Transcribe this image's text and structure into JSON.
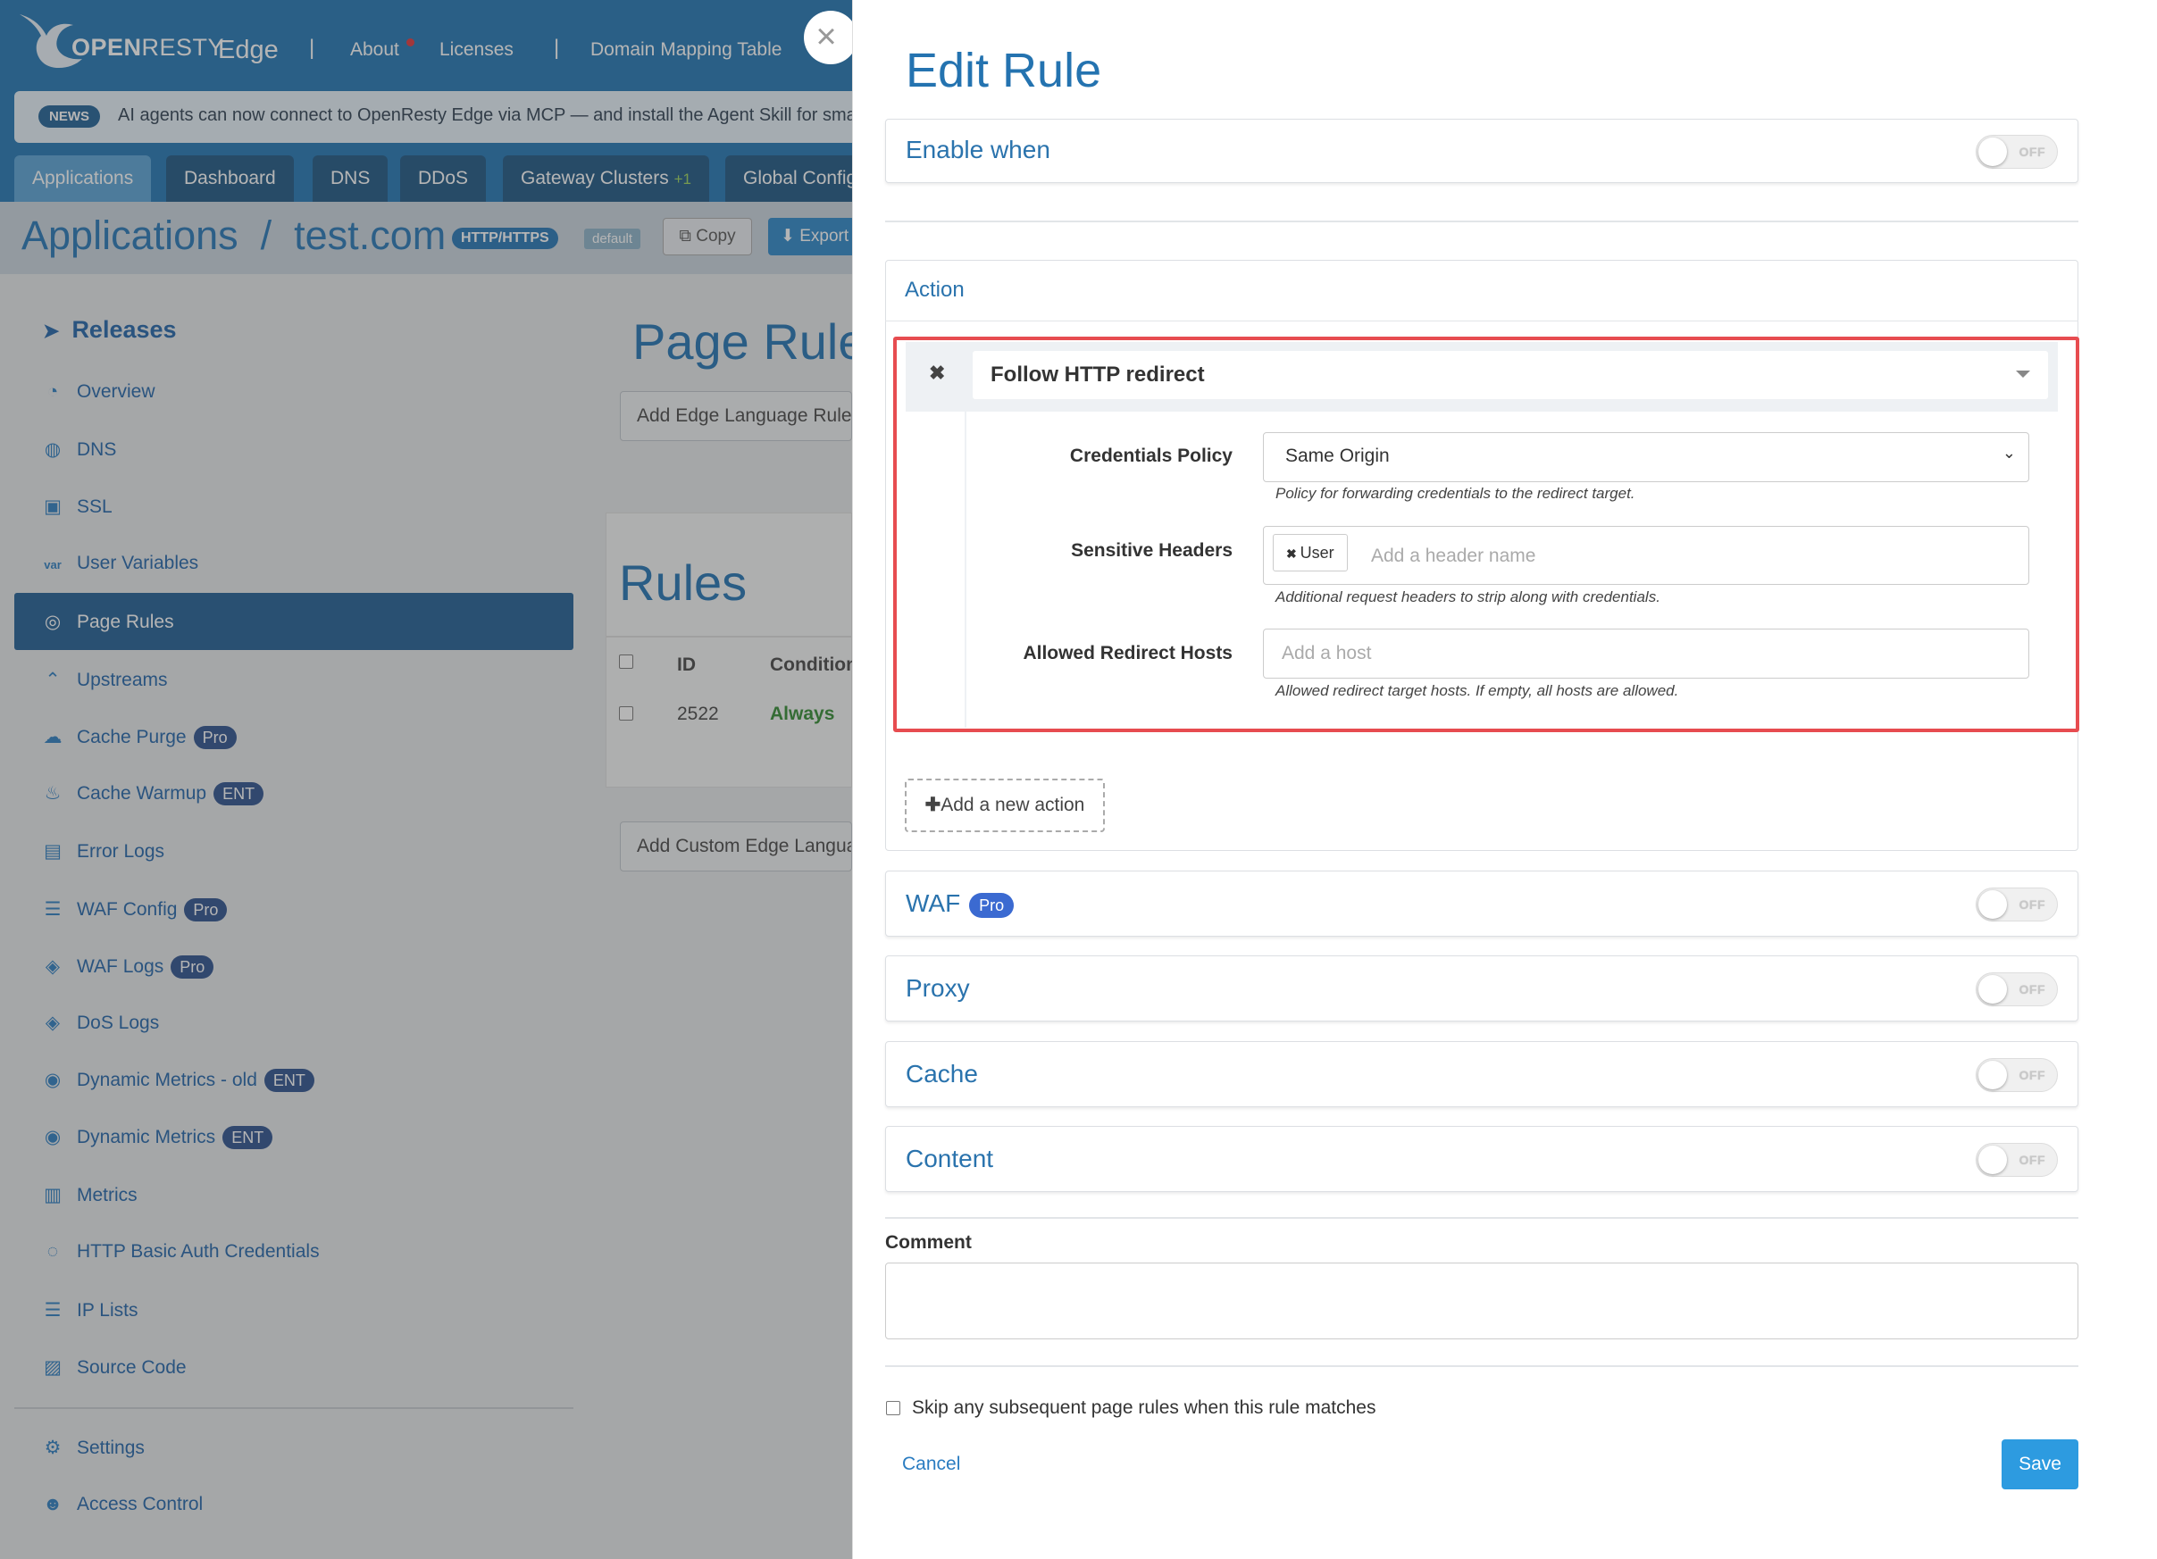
{
  "app": {
    "brand_open": "OPEN",
    "brand_resty": "RESTY",
    "brand_edge": "Edge",
    "top_links": [
      "About",
      "Licenses",
      "Domain Mapping Table"
    ],
    "news_badge": "NEWS",
    "news_text": "AI agents can now connect to OpenResty Edge via MCP — and install the Agent Skill for smarter",
    "tabs": [
      {
        "label": "Applications",
        "active": true
      },
      {
        "label": "Dashboard"
      },
      {
        "label": "DNS"
      },
      {
        "label": "DDoS"
      },
      {
        "label": "Gateway Clusters",
        "extra": "+1"
      },
      {
        "label": "Global Config"
      }
    ],
    "breadcrumb": "Applications  /  test.com",
    "badge_http": "HTTP/HTTPS",
    "badge_default": "default",
    "copy_label": "Copy",
    "export_label": "Export"
  },
  "sidebar": {
    "section": "Releases",
    "items": [
      {
        "label": "Overview",
        "icon": "gauge-icon"
      },
      {
        "label": "DNS",
        "icon": "globe-icon"
      },
      {
        "label": "SSL",
        "icon": "certificate-icon"
      },
      {
        "label": "User Variables",
        "icon": "var-icon"
      },
      {
        "label": "Page Rules",
        "icon": "rules-icon",
        "active": true
      },
      {
        "label": "Upstreams",
        "icon": "upstream-icon"
      },
      {
        "label": "Cache Purge",
        "icon": "cloud-icon",
        "badge": "Pro"
      },
      {
        "label": "Cache Warmup",
        "icon": "flame-icon",
        "badge": "ENT"
      },
      {
        "label": "Error Logs",
        "icon": "log-icon"
      },
      {
        "label": "WAF Config",
        "icon": "list-icon",
        "badge": "Pro"
      },
      {
        "label": "WAF Logs",
        "icon": "shield-icon",
        "badge": "Pro"
      },
      {
        "label": "DoS Logs",
        "icon": "shield-icon"
      },
      {
        "label": "Dynamic Metrics - old",
        "icon": "pin-icon",
        "badge": "ENT"
      },
      {
        "label": "Dynamic Metrics",
        "icon": "pin-icon",
        "badge": "ENT"
      },
      {
        "label": "Metrics",
        "icon": "bar-chart-icon"
      },
      {
        "label": "HTTP Basic Auth Credentials",
        "icon": "key-icon"
      },
      {
        "label": "IP Lists",
        "icon": "list-icon"
      },
      {
        "label": "Source Code",
        "icon": "code-icon"
      },
      {
        "label": "Settings",
        "icon": "gear-icon"
      },
      {
        "label": "Access Control",
        "icon": "user-icon"
      }
    ]
  },
  "middle": {
    "title": "Page Rules",
    "add_edge_button": "Add Edge Language Rule",
    "rules_title": "Rules",
    "col_id": "ID",
    "col_condition": "Condition",
    "row_id": "2522",
    "row_condition": "Always",
    "add_custom_button": "Add Custom Edge Language"
  },
  "drawer": {
    "title": "Edit Rule",
    "enable_when": "Enable when",
    "toggle_off": "OFF",
    "action_title": "Action",
    "action_select": "Follow HTTP redirect",
    "credentials_label": "Credentials Policy",
    "credentials_value": "Same Origin",
    "credentials_help": "Policy for forwarding credentials to the redirect target.",
    "sensitive_label": "Sensitive Headers",
    "sensitive_tag": "User",
    "sensitive_placeholder": "Add a header name",
    "sensitive_help": "Additional request headers to strip along with credentials.",
    "allowed_label": "Allowed Redirect Hosts",
    "allowed_placeholder": "Add a host",
    "allowed_help": "Allowed redirect target hosts. If empty, all hosts are allowed.",
    "add_action": "Add a new action",
    "waf": "WAF",
    "waf_badge": "Pro",
    "proxy": "Proxy",
    "cache": "Cache",
    "content": "Content",
    "comment_label": "Comment",
    "skip_label": "Skip any subsequent page rules when this rule matches",
    "cancel": "Cancel",
    "save": "Save"
  },
  "colors": {
    "accent": "#2473b0",
    "highlight": "#e74c50",
    "save": "#2d9be0"
  }
}
